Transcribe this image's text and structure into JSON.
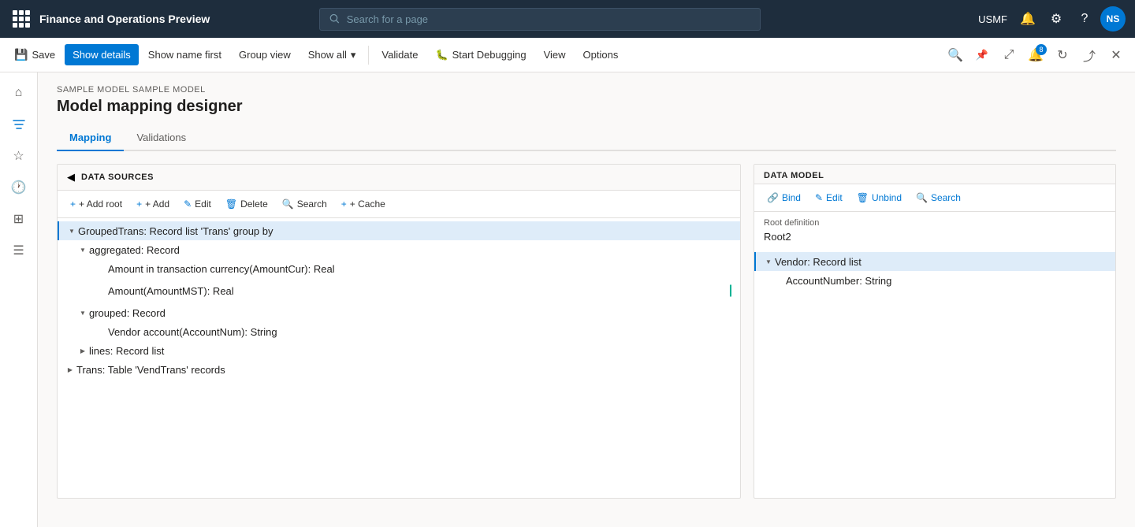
{
  "app": {
    "title": "Finance and Operations Preview",
    "search_placeholder": "Search for a page",
    "user": "USMF",
    "avatar": "NS"
  },
  "cmdbar": {
    "save_label": "Save",
    "show_details_label": "Show details",
    "show_name_first_label": "Show name first",
    "group_view_label": "Group view",
    "show_all_label": "Show all",
    "validate_label": "Validate",
    "start_debugging_label": "Start Debugging",
    "view_label": "View",
    "options_label": "Options"
  },
  "page": {
    "breadcrumb": "SAMPLE MODEL SAMPLE MODEL",
    "title": "Model mapping designer",
    "tabs": [
      {
        "label": "Mapping",
        "active": true
      },
      {
        "label": "Validations",
        "active": false
      }
    ]
  },
  "data_sources": {
    "section_title": "DATA SOURCES",
    "toolbar": {
      "add_root": "+ Add root",
      "add": "+ Add",
      "edit": "Edit",
      "delete": "Delete",
      "search": "Search",
      "cache": "+ Cache"
    },
    "tree": [
      {
        "id": "grouped-trans",
        "label": "GroupedTrans: Record list 'Trans' group by",
        "indent": 0,
        "expanded": true,
        "selected": true,
        "children": [
          {
            "id": "aggregated",
            "label": "aggregated: Record",
            "indent": 1,
            "expanded": true,
            "children": [
              {
                "id": "amount-cur",
                "label": "Amount in transaction currency(AmountCur): Real",
                "indent": 2,
                "binding": false
              },
              {
                "id": "amount-mst",
                "label": "Amount(AmountMST): Real",
                "indent": 2,
                "binding": true
              }
            ]
          },
          {
            "id": "grouped",
            "label": "grouped: Record",
            "indent": 1,
            "expanded": true,
            "children": [
              {
                "id": "vendor-acct",
                "label": "Vendor account(AccountNum): String",
                "indent": 2,
                "binding": false
              }
            ]
          },
          {
            "id": "lines",
            "label": "lines: Record list",
            "indent": 1,
            "expanded": false
          }
        ]
      },
      {
        "id": "trans",
        "label": "Trans: Table 'VendTrans' records",
        "indent": 0,
        "expanded": false
      }
    ]
  },
  "data_model": {
    "section_title": "DATA MODEL",
    "toolbar": {
      "bind": "Bind",
      "edit": "Edit",
      "unbind": "Unbind",
      "search": "Search"
    },
    "root_definition_label": "Root definition",
    "root_definition_value": "Root2",
    "tree": [
      {
        "id": "vendor",
        "label": "Vendor: Record list",
        "indent": 0,
        "expanded": true,
        "selected": true,
        "children": [
          {
            "id": "account-number",
            "label": "AccountNumber: String",
            "indent": 1
          }
        ]
      }
    ]
  }
}
